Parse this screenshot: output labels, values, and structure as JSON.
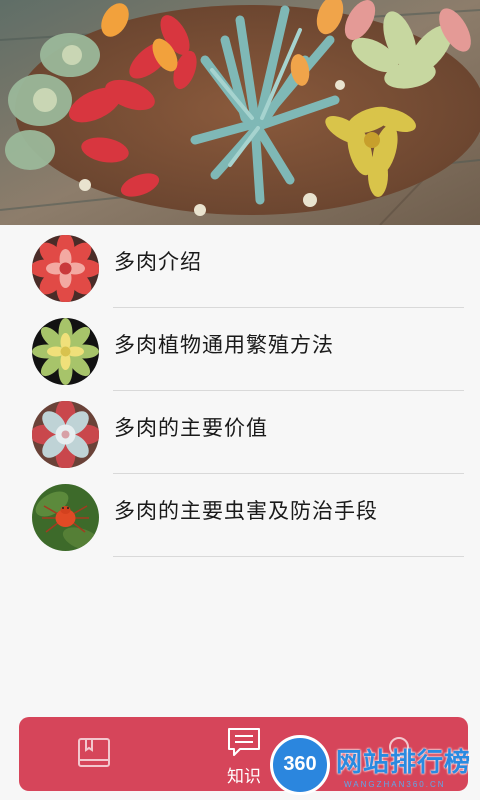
{
  "banner": {
    "image": "succulent-wreath-photo"
  },
  "list": {
    "items": [
      {
        "label": "多肉介绍",
        "thumb": "red-succulent-photo"
      },
      {
        "label": "多肉植物通用繁殖方法",
        "thumb": "yellow-succulent-photo"
      },
      {
        "label": "多肉的主要价值",
        "thumb": "pink-succulent-photo"
      },
      {
        "label": "多肉的主要虫害及防治手段",
        "thumb": "red-spider-mite-photo"
      }
    ]
  },
  "tabbar": {
    "tabs": [
      {
        "icon": "book-icon",
        "label": ""
      },
      {
        "icon": "message-icon",
        "label": "知识"
      },
      {
        "icon": "search-icon",
        "label": ""
      }
    ]
  },
  "watermark": {
    "badge": "360",
    "title": "网站排行榜",
    "subtitle": "WANGZHAN360.CN"
  },
  "colors": {
    "accent": "#d6455a",
    "background": "#f7f7f7",
    "divider": "#d9d9d9",
    "watermark": "#2a8ae0"
  }
}
